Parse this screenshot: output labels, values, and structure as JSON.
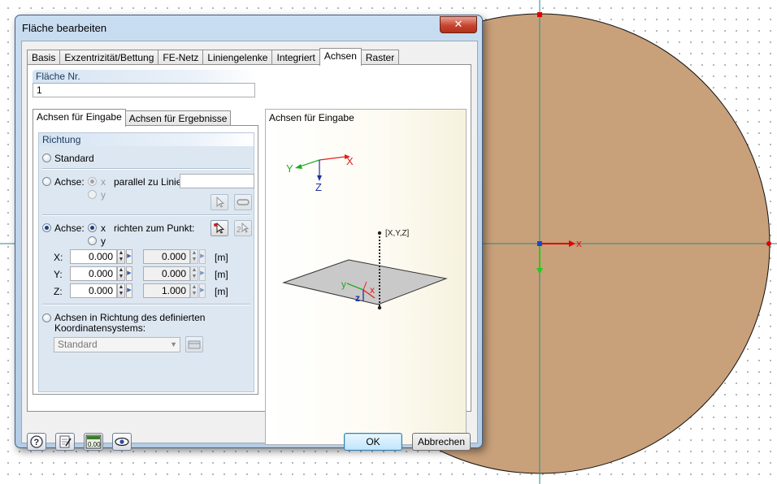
{
  "background": {
    "fill_color": "#c8a07a",
    "axis_x_label": "X"
  },
  "dialog": {
    "title": "Fläche bearbeiten",
    "close_label": "✕",
    "tabs": [
      {
        "label": "Basis",
        "active": false
      },
      {
        "label": "Exzentrizität/Bettung",
        "active": false
      },
      {
        "label": "FE-Netz",
        "active": false
      },
      {
        "label": "Liniengelenke",
        "active": false
      },
      {
        "label": "Integriert",
        "active": false
      },
      {
        "label": "Achsen",
        "active": true
      },
      {
        "label": "Raster",
        "active": false
      }
    ],
    "surface_no": {
      "header": "Fläche Nr.",
      "value": "1"
    },
    "subtabs": [
      {
        "label": "Achsen für Eingabe",
        "active": true
      },
      {
        "label": "Achsen für Ergebnisse",
        "active": false
      }
    ],
    "direction": {
      "header": "Richtung",
      "standard_label": "Standard",
      "axis_line": {
        "label": "Achse:",
        "x": "x",
        "y": "y",
        "parallel_label": "parallel zu Linie:",
        "line_value": ""
      },
      "axis_point": {
        "label": "Achse:",
        "x": "x",
        "y": "y",
        "point_label": "richten zum Punkt:"
      },
      "coords": [
        {
          "label": "X:",
          "value": "0.000",
          "result": "0.000",
          "unit": "[m]"
        },
        {
          "label": "Y:",
          "value": "0.000",
          "result": "0.000",
          "unit": "[m]"
        },
        {
          "label": "Z:",
          "value": "0.000",
          "result": "1.000",
          "unit": "[m]"
        }
      ],
      "coord_system_label_1": "Achsen in Richtung des definierten",
      "coord_system_label_2": "Koordinatensystems:",
      "coord_system_value": "Standard"
    },
    "preview": {
      "title": "Achsen für Eingabe",
      "axis_x": "X",
      "axis_y": "Y",
      "axis_z": "Z",
      "point_label": "[X,Y,Z]",
      "local_x": "x",
      "local_y": "y",
      "local_z": "z"
    },
    "buttons": {
      "ok": "OK",
      "cancel": "Abbrechen",
      "units_label": "0.00"
    }
  }
}
